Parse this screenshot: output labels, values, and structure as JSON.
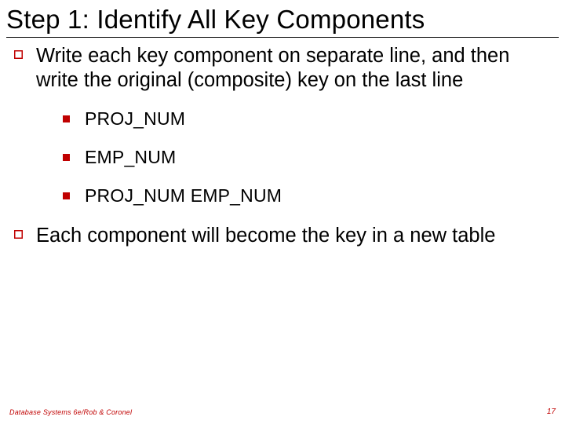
{
  "title": "Step 1: Identify All Key Components",
  "bullets": {
    "b0": "Write each key component on separate line, and then write the original (composite) key on the last line",
    "b1": "Each component will become the key in a new table"
  },
  "sub": {
    "s0": "PROJ_NUM",
    "s1": "EMP_NUM",
    "s2": "PROJ_NUM   EMP_NUM"
  },
  "footer": {
    "source": "Database Systems 6e/Rob & Coronel",
    "page": "17"
  }
}
